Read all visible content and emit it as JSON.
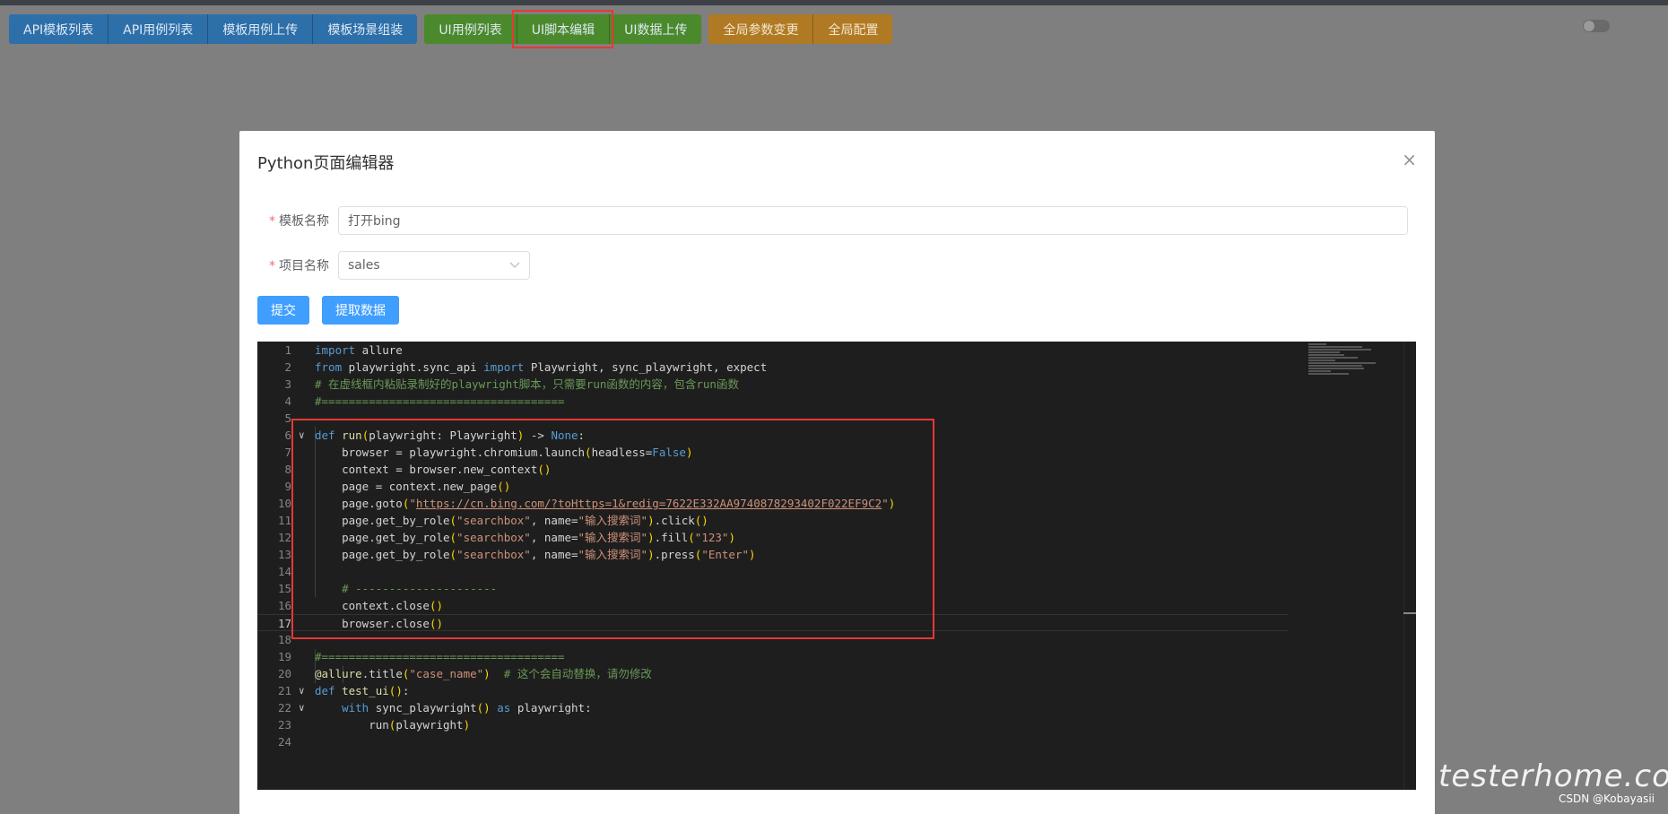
{
  "toolbar": {
    "groups": [
      {
        "color": "blue",
        "items": [
          "API模板列表",
          "API用例列表",
          "模板用例上传",
          "模板场景组装"
        ]
      },
      {
        "color": "green",
        "items": [
          "UI用例列表",
          "UI脚本编辑",
          "UI数据上传"
        ]
      },
      {
        "color": "orange",
        "items": [
          "全局参数变更",
          "全局配置"
        ]
      }
    ],
    "active_item": "UI脚本编辑"
  },
  "dialog": {
    "title": "Python页面编辑器",
    "close_glyph": "×",
    "template_name_label": "模板名称",
    "template_name_value": "打开bing",
    "project_name_label": "项目名称",
    "project_name_value": "sales",
    "required_mark": "*",
    "submit_label": "提交",
    "extract_label": "提取数据"
  },
  "editor": {
    "active_line": 17,
    "lines": [
      "import allure",
      "from playwright.sync_api import Playwright, sync_playwright, expect",
      "# 在虚线框内粘贴录制好的playwright脚本，只需要run函数的内容，包含run函数",
      "#====================================",
      "",
      "def run(playwright: Playwright) -> None:",
      "    browser = playwright.chromium.launch(headless=False)",
      "    context = browser.new_context()",
      "    page = context.new_page()",
      "    page.goto(\"https://cn.bing.com/?toHttps=1&redig=7622E332AA9740878293402F022EF9C2\")",
      "    page.get_by_role(\"searchbox\", name=\"输入搜索词\").click()",
      "    page.get_by_role(\"searchbox\", name=\"输入搜索词\").fill(\"123\")",
      "    page.get_by_role(\"searchbox\", name=\"输入搜索词\").press(\"Enter\")",
      "",
      "    # ---------------------",
      "    context.close()",
      "    browser.close()",
      "",
      "#====================================",
      "@allure.title(\"case_name\")  # 这个会自动替换，请勿修改",
      "def test_ui():",
      "    with sync_playwright() as playwright:",
      "        run(playwright)",
      ""
    ]
  },
  "watermark": "testerhome.com",
  "credit": "CSDN @Kobayasii"
}
